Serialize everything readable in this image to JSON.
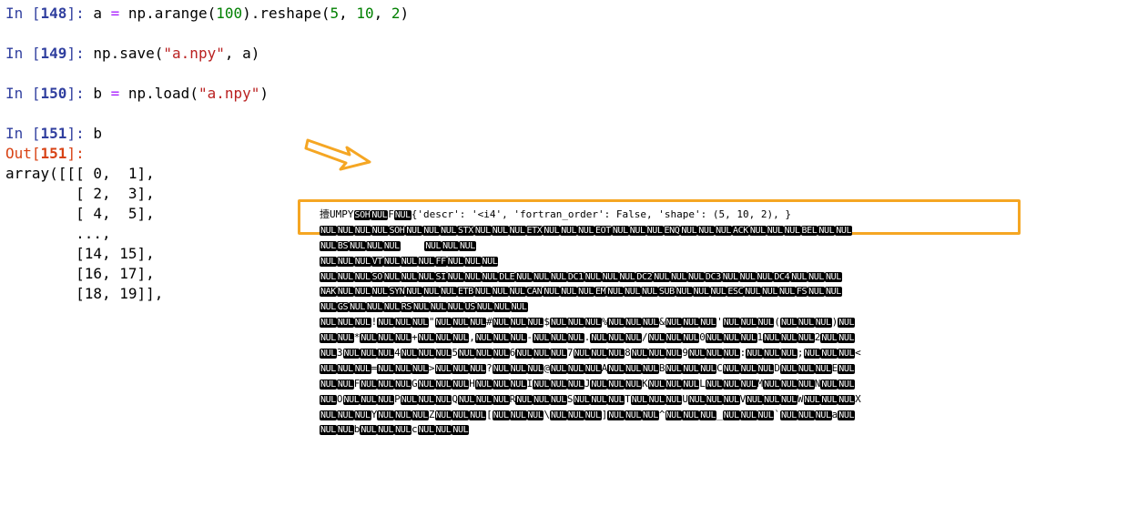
{
  "cells": [
    {
      "in_label": "In [",
      "count": "148",
      "close": "]:",
      "code": [
        {
          "t": "a ",
          "c": ""
        },
        {
          "t": "=",
          "c": "op"
        },
        {
          "t": " np.arange(",
          "c": ""
        },
        {
          "t": "100",
          "c": "num"
        },
        {
          "t": ").reshape(",
          "c": ""
        },
        {
          "t": "5",
          "c": "num"
        },
        {
          "t": ", ",
          "c": ""
        },
        {
          "t": "10",
          "c": "num"
        },
        {
          "t": ", ",
          "c": ""
        },
        {
          "t": "2",
          "c": "num"
        },
        {
          "t": ")",
          "c": ""
        }
      ]
    },
    {
      "in_label": "In [",
      "count": "149",
      "close": "]:",
      "code": [
        {
          "t": "np.save(",
          "c": ""
        },
        {
          "t": "\"a.npy\"",
          "c": "str"
        },
        {
          "t": ", a)",
          "c": ""
        }
      ]
    },
    {
      "in_label": "In [",
      "count": "150",
      "close": "]:",
      "code": [
        {
          "t": "b ",
          "c": ""
        },
        {
          "t": "=",
          "c": "op"
        },
        {
          "t": " np.load(",
          "c": ""
        },
        {
          "t": "\"a.npy\"",
          "c": "str"
        },
        {
          "t": ")",
          "c": ""
        }
      ]
    },
    {
      "in_label": "In [",
      "count": "151",
      "close": "]:",
      "code": [
        {
          "t": "b",
          "c": ""
        }
      ]
    }
  ],
  "output": {
    "label": "Out[",
    "count": "151",
    "close": "]:",
    "lines": [
      "array([[[ 0,  1],",
      "        [ 2,  3],",
      "        [ 4,  5],",
      "        ...,",
      "        [14, 15],",
      "        [16, 17],",
      "        [18, 19]],"
    ]
  },
  "dump": {
    "header_text": "{'descr': '<i4', 'fortran_order': False, 'shape': (5, 10, 2), }",
    "rows": [
      [
        "t:撎UMPY",
        "c:SOH",
        "c:NUL",
        "t:F",
        "c:NUL",
        "t:{'descr': '<i4', 'fortran_order': False, 'shape': (5, 10, 2), }"
      ],
      [
        "c:NUL",
        "c:NUL",
        "c:NUL",
        "c:NUL",
        "c:SOH",
        "c:NUL",
        "c:NUL",
        "c:NUL",
        "c:STX",
        "c:NUL",
        "c:NUL",
        "c:NUL",
        "c:ETX",
        "c:NUL",
        "c:NUL",
        "c:NUL",
        "c:EOT",
        "c:NUL",
        "c:NUL",
        "c:NUL",
        "c:ENQ",
        "c:NUL",
        "c:NUL",
        "c:NUL",
        "c:ACK",
        "c:NUL",
        "c:NUL",
        "c:NUL",
        "c:BEL",
        "c:NUL",
        "c:NUL"
      ],
      [
        "c:NUL",
        "c:BS",
        "c:NUL",
        "c:NUL",
        "c:NUL",
        "t:    ",
        "c:NUL",
        "c:NUL",
        "c:NUL"
      ],
      [
        "c:NUL",
        "c:NUL",
        "c:NUL",
        "c:VT",
        "c:NUL",
        "c:NUL",
        "c:NUL",
        "c:FF",
        "c:NUL",
        "c:NUL",
        "c:NUL"
      ],
      [
        "c:NUL",
        "c:NUL",
        "c:NUL",
        "c:SO",
        "c:NUL",
        "c:NUL",
        "c:NUL",
        "c:SI",
        "c:NUL",
        "c:NUL",
        "c:NUL",
        "c:DLE",
        "c:NUL",
        "c:NUL",
        "c:NUL",
        "c:DC1",
        "c:NUL",
        "c:NUL",
        "c:NUL",
        "c:DC2",
        "c:NUL",
        "c:NUL",
        "c:NUL",
        "c:DC3",
        "c:NUL",
        "c:NUL",
        "c:NUL",
        "c:DC4",
        "c:NUL",
        "c:NUL",
        "c:NUL"
      ],
      [
        "c:NAK",
        "c:NUL",
        "c:NUL",
        "c:NUL",
        "c:SYN",
        "c:NUL",
        "c:NUL",
        "c:NUL",
        "c:ETB",
        "c:NUL",
        "c:NUL",
        "c:NUL",
        "c:CAN",
        "c:NUL",
        "c:NUL",
        "c:NUL",
        "c:EM",
        "c:NUL",
        "c:NUL",
        "c:NUL",
        "c:SUB",
        "c:NUL",
        "c:NUL",
        "c:NUL",
        "c:ESC",
        "c:NUL",
        "c:NUL",
        "c:NUL",
        "c:FS",
        "c:NUL",
        "c:NUL"
      ],
      [
        "c:NUL",
        "c:GS",
        "c:NUL",
        "c:NUL",
        "c:NUL",
        "c:RS",
        "c:NUL",
        "c:NUL",
        "c:NUL",
        "c:US",
        "c:NUL",
        "c:NUL",
        "c:NUL"
      ],
      [
        "c:NUL",
        "c:NUL",
        "c:NUL",
        "t:!",
        "c:NUL",
        "c:NUL",
        "c:NUL",
        "t:\"",
        "c:NUL",
        "c:NUL",
        "c:NUL",
        "t:#",
        "c:NUL",
        "c:NUL",
        "c:NUL",
        "t:$",
        "c:NUL",
        "c:NUL",
        "c:NUL",
        "t:%",
        "c:NUL",
        "c:NUL",
        "c:NUL",
        "t:&",
        "c:NUL",
        "c:NUL",
        "c:NUL",
        "t:'",
        "c:NUL",
        "c:NUL",
        "c:NUL",
        "t:(",
        "c:NUL",
        "c:NUL",
        "c:NUL",
        "t:)",
        "c:NUL"
      ],
      [
        "c:NUL",
        "c:NUL",
        "t:*",
        "c:NUL",
        "c:NUL",
        "c:NUL",
        "t:+",
        "c:NUL",
        "c:NUL",
        "c:NUL",
        "t:,",
        "c:NUL",
        "c:NUL",
        "c:NUL",
        "t:-",
        "c:NUL",
        "c:NUL",
        "c:NUL",
        "t:.",
        "c:NUL",
        "c:NUL",
        "c:NUL",
        "t:/",
        "c:NUL",
        "c:NUL",
        "c:NUL",
        "t:0",
        "c:NUL",
        "c:NUL",
        "c:NUL",
        "t:1",
        "c:NUL",
        "c:NUL",
        "c:NUL",
        "t:2",
        "c:NUL",
        "c:NUL"
      ],
      [
        "c:NUL",
        "t:3",
        "c:NUL",
        "c:NUL",
        "c:NUL",
        "t:4",
        "c:NUL",
        "c:NUL",
        "c:NUL",
        "t:5",
        "c:NUL",
        "c:NUL",
        "c:NUL",
        "t:6",
        "c:NUL",
        "c:NUL",
        "c:NUL",
        "t:7",
        "c:NUL",
        "c:NUL",
        "c:NUL",
        "t:8",
        "c:NUL",
        "c:NUL",
        "c:NUL",
        "t:9",
        "c:NUL",
        "c:NUL",
        "c:NUL",
        "t::",
        "c:NUL",
        "c:NUL",
        "c:NUL",
        "t:;",
        "c:NUL",
        "c:NUL",
        "c:NUL",
        "t:<"
      ],
      [
        "c:NUL",
        "c:NUL",
        "c:NUL",
        "t:=",
        "c:NUL",
        "c:NUL",
        "c:NUL",
        "t:>",
        "c:NUL",
        "c:NUL",
        "c:NUL",
        "t:?",
        "c:NUL",
        "c:NUL",
        "c:NUL",
        "t:@",
        "c:NUL",
        "c:NUL",
        "c:NUL",
        "t:A",
        "c:NUL",
        "c:NUL",
        "c:NUL",
        "t:B",
        "c:NUL",
        "c:NUL",
        "c:NUL",
        "t:C",
        "c:NUL",
        "c:NUL",
        "c:NUL",
        "t:D",
        "c:NUL",
        "c:NUL",
        "c:NUL",
        "t:E",
        "c:NUL"
      ],
      [
        "c:NUL",
        "c:NUL",
        "t:F",
        "c:NUL",
        "c:NUL",
        "c:NUL",
        "t:G",
        "c:NUL",
        "c:NUL",
        "c:NUL",
        "t:H",
        "c:NUL",
        "c:NUL",
        "c:NUL",
        "t:I",
        "c:NUL",
        "c:NUL",
        "c:NUL",
        "t:J",
        "c:NUL",
        "c:NUL",
        "c:NUL",
        "t:K",
        "c:NUL",
        "c:NUL",
        "c:NUL",
        "t:L",
        "c:NUL",
        "c:NUL",
        "c:NUL",
        "t:M",
        "c:NUL",
        "c:NUL",
        "c:NUL",
        "t:N",
        "c:NUL",
        "c:NUL"
      ],
      [
        "c:NUL",
        "t:O",
        "c:NUL",
        "c:NUL",
        "c:NUL",
        "t:P",
        "c:NUL",
        "c:NUL",
        "c:NUL",
        "t:Q",
        "c:NUL",
        "c:NUL",
        "c:NUL",
        "t:R",
        "c:NUL",
        "c:NUL",
        "c:NUL",
        "t:S",
        "c:NUL",
        "c:NUL",
        "c:NUL",
        "t:T",
        "c:NUL",
        "c:NUL",
        "c:NUL",
        "t:U",
        "c:NUL",
        "c:NUL",
        "c:NUL",
        "t:V",
        "c:NUL",
        "c:NUL",
        "c:NUL",
        "t:W",
        "c:NUL",
        "c:NUL",
        "c:NUL",
        "t:X"
      ],
      [
        "c:NUL",
        "c:NUL",
        "c:NUL",
        "t:Y",
        "c:NUL",
        "c:NUL",
        "c:NUL",
        "t:Z",
        "c:NUL",
        "c:NUL",
        "c:NUL",
        "t:[",
        "c:NUL",
        "c:NUL",
        "c:NUL",
        "t:\\",
        "c:NUL",
        "c:NUL",
        "c:NUL",
        "t:]",
        "c:NUL",
        "c:NUL",
        "c:NUL",
        "t:^",
        "c:NUL",
        "c:NUL",
        "c:NUL",
        "t:_",
        "c:NUL",
        "c:NUL",
        "c:NUL",
        "t:`",
        "c:NUL",
        "c:NUL",
        "c:NUL",
        "t:a",
        "c:NUL"
      ],
      [
        "c:NUL",
        "c:NUL",
        "t:b",
        "c:NUL",
        "c:NUL",
        "c:NUL",
        "t:c",
        "c:NUL",
        "c:NUL",
        "c:NUL"
      ]
    ]
  },
  "colors": {
    "in_prompt": "#303f9f",
    "out_prompt": "#d84315",
    "highlight_box": "#f5a623",
    "arrow": "#f5a623"
  },
  "icons": [
    "arrow-right-icon"
  ]
}
